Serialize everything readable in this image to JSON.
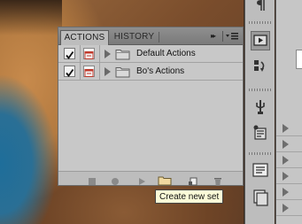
{
  "panel": {
    "tabs": [
      {
        "label": "ACTIONS",
        "active": true
      },
      {
        "label": "HISTORY",
        "active": false
      }
    ],
    "collapse_glyph": "▸▸",
    "menu_icon": "panel-menu-icon",
    "action_sets": [
      {
        "label": "Default Actions",
        "enabled": true,
        "icon": "folder-icon"
      },
      {
        "label": "Bo's Actions",
        "enabled": true,
        "icon": "folder-icon"
      }
    ],
    "bottom_buttons": [
      {
        "name": "stop-playing-recording-button",
        "icon": "stop-icon"
      },
      {
        "name": "begin-recording-button",
        "icon": "record-icon"
      },
      {
        "name": "play-selection-button",
        "icon": "play-icon"
      },
      {
        "name": "create-new-set-button",
        "icon": "folder-icon"
      },
      {
        "name": "create-new-action-button",
        "icon": "new-item-icon"
      },
      {
        "name": "delete-button",
        "icon": "trash-icon"
      }
    ]
  },
  "tooltip": {
    "text": "Create new set"
  },
  "colors": {
    "panel_bg": "#bdbdbd",
    "list_bg": "#c8c8c8",
    "tooltip_bg": "#fbfbd8",
    "dialog_toggle_red": "#c0392b"
  }
}
